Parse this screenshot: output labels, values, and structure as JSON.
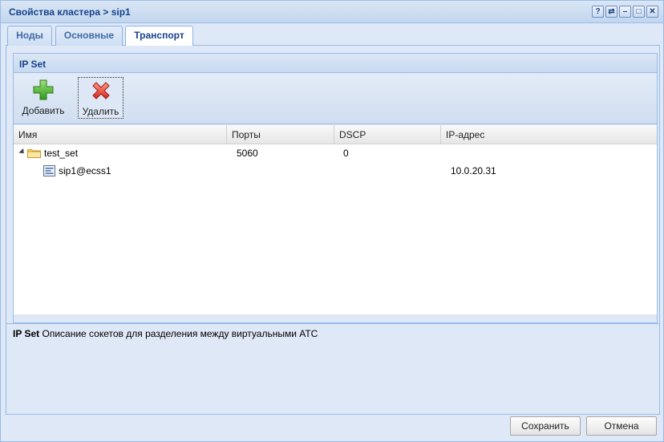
{
  "window": {
    "title": "Свойства кластера > sip1"
  },
  "title_tools": [
    {
      "name": "help-icon",
      "glyph": "?"
    },
    {
      "name": "refresh-icon",
      "glyph": "⇄"
    },
    {
      "name": "minimize-icon",
      "glyph": "–"
    },
    {
      "name": "maximize-icon",
      "glyph": "□"
    },
    {
      "name": "close-icon",
      "glyph": "✕"
    }
  ],
  "tabs": [
    {
      "label": "Ноды",
      "active": false
    },
    {
      "label": "Основные",
      "active": false
    },
    {
      "label": "Транспорт",
      "active": true
    }
  ],
  "panel": {
    "title": "IP Set"
  },
  "toolbar": {
    "add_label": "Добавить",
    "delete_label": "Удалить"
  },
  "grid": {
    "columns": [
      "Имя",
      "Порты",
      "DSCP",
      "IP-адрес"
    ],
    "rows": [
      {
        "name": "test_set",
        "ports": "5060",
        "dscp": "0",
        "ip": "",
        "type": "folder",
        "expanded": true
      },
      {
        "name": "sip1@ecss1",
        "ports": "",
        "dscp": "",
        "ip": "10.0.20.31",
        "type": "leaf"
      }
    ]
  },
  "description": {
    "title": "IP Set",
    "text": "Описание сокетов для разделения между виртуальными АТС"
  },
  "footer": {
    "save_label": "Сохранить",
    "cancel_label": "Отмена"
  },
  "colors": {
    "header_text": "#15428b",
    "border": "#99bbe8",
    "background": "#dfe8f6"
  }
}
